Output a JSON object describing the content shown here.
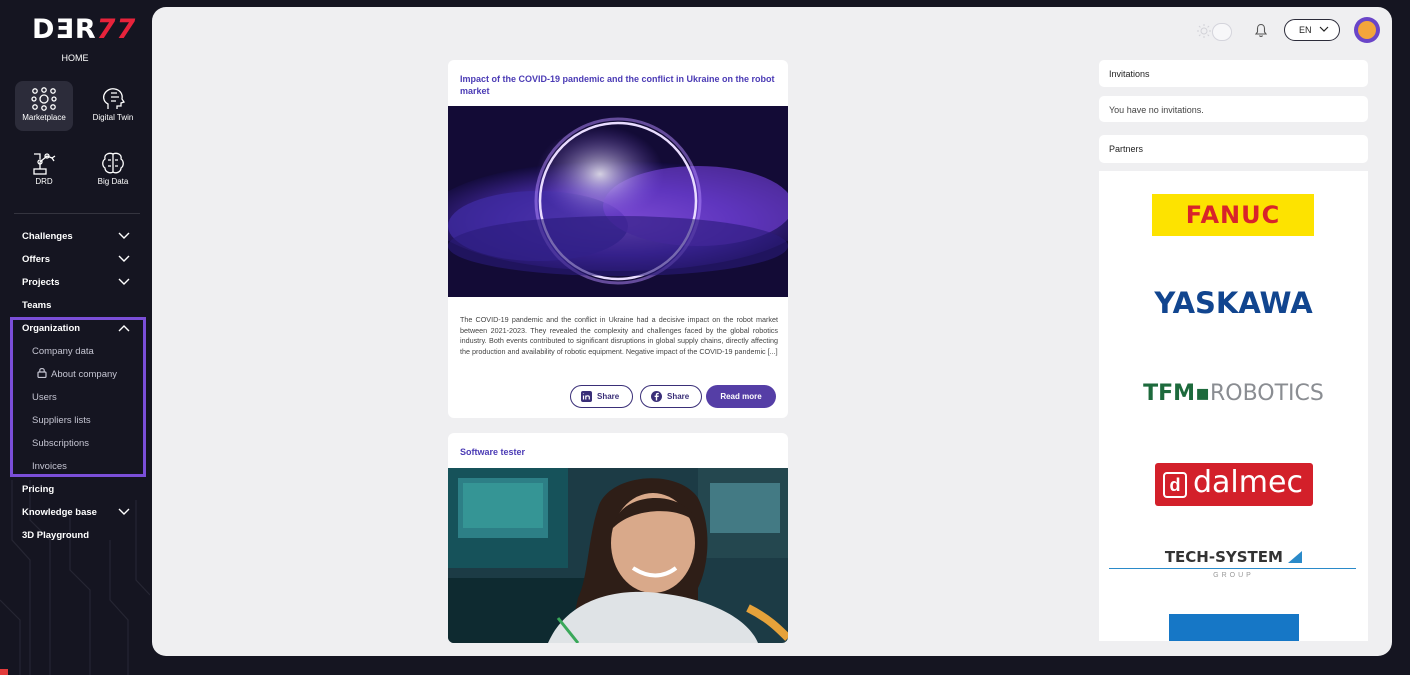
{
  "sidebar": {
    "logo_main": "DƎR",
    "logo_accent": "77",
    "home_label": "HOME",
    "apps": [
      {
        "label": "Marketplace",
        "icon": "marketplace-network-icon",
        "active": true
      },
      {
        "label": "Digital Twin",
        "icon": "digital-twin-head-icon",
        "active": false
      },
      {
        "label": "DRD",
        "icon": "drd-robot-arm-icon",
        "active": false
      },
      {
        "label": "Big Data",
        "icon": "big-data-brain-icon",
        "active": false
      }
    ],
    "nav": {
      "challenges": "Challenges",
      "offers": "Offers",
      "projects": "Projects",
      "teams": "Teams",
      "organization": "Organization",
      "pricing": "Pricing",
      "knowledge_base": "Knowledge base",
      "playground": "3D Playground"
    },
    "organization_sub": {
      "company_data": "Company data",
      "about_company": "About company",
      "users": "Users",
      "suppliers": "Suppliers lists",
      "subscriptions": "Subscriptions",
      "invoices": "Invoices"
    },
    "highlight_color": "#7b4fd8"
  },
  "topbar": {
    "language": "EN"
  },
  "feed": {
    "card1": {
      "title": "Impact of the COVID-19 pandemic and the conflict in Ukraine on the robot market",
      "text": "The COVID-19 pandemic and the conflict in Ukraine had a decisive impact on the robot market between 2021-2023. They revealed the complexity and challenges faced by the global robotics industry. Both events contributed to significant disruptions in global supply chains, directly affecting the production and availability of robotic equipment. Negative impact of the COVID-19 pandemic [...]",
      "share_linkedin": "Share",
      "share_facebook": "Share",
      "read_more": "Read more"
    },
    "card2": {
      "title": "Software tester"
    }
  },
  "right": {
    "invitations_header": "Invitations",
    "invitations_empty": "You have no invitations.",
    "partners_header": "Partners",
    "partners": {
      "fanuc": "FANUC",
      "yaskawa": "YASKAWA",
      "tfm_bold": "TFM",
      "tfm_rest": "ROBOTICS",
      "dalmec_mark": "d",
      "dalmec": "dalmec",
      "tech_system": "TECH-SYSTEM",
      "tech_group": "GROUP"
    }
  },
  "colors": {
    "accent": "#553ea6",
    "title_text": "#4b3bb5",
    "sidebar_bg": "#151521"
  }
}
